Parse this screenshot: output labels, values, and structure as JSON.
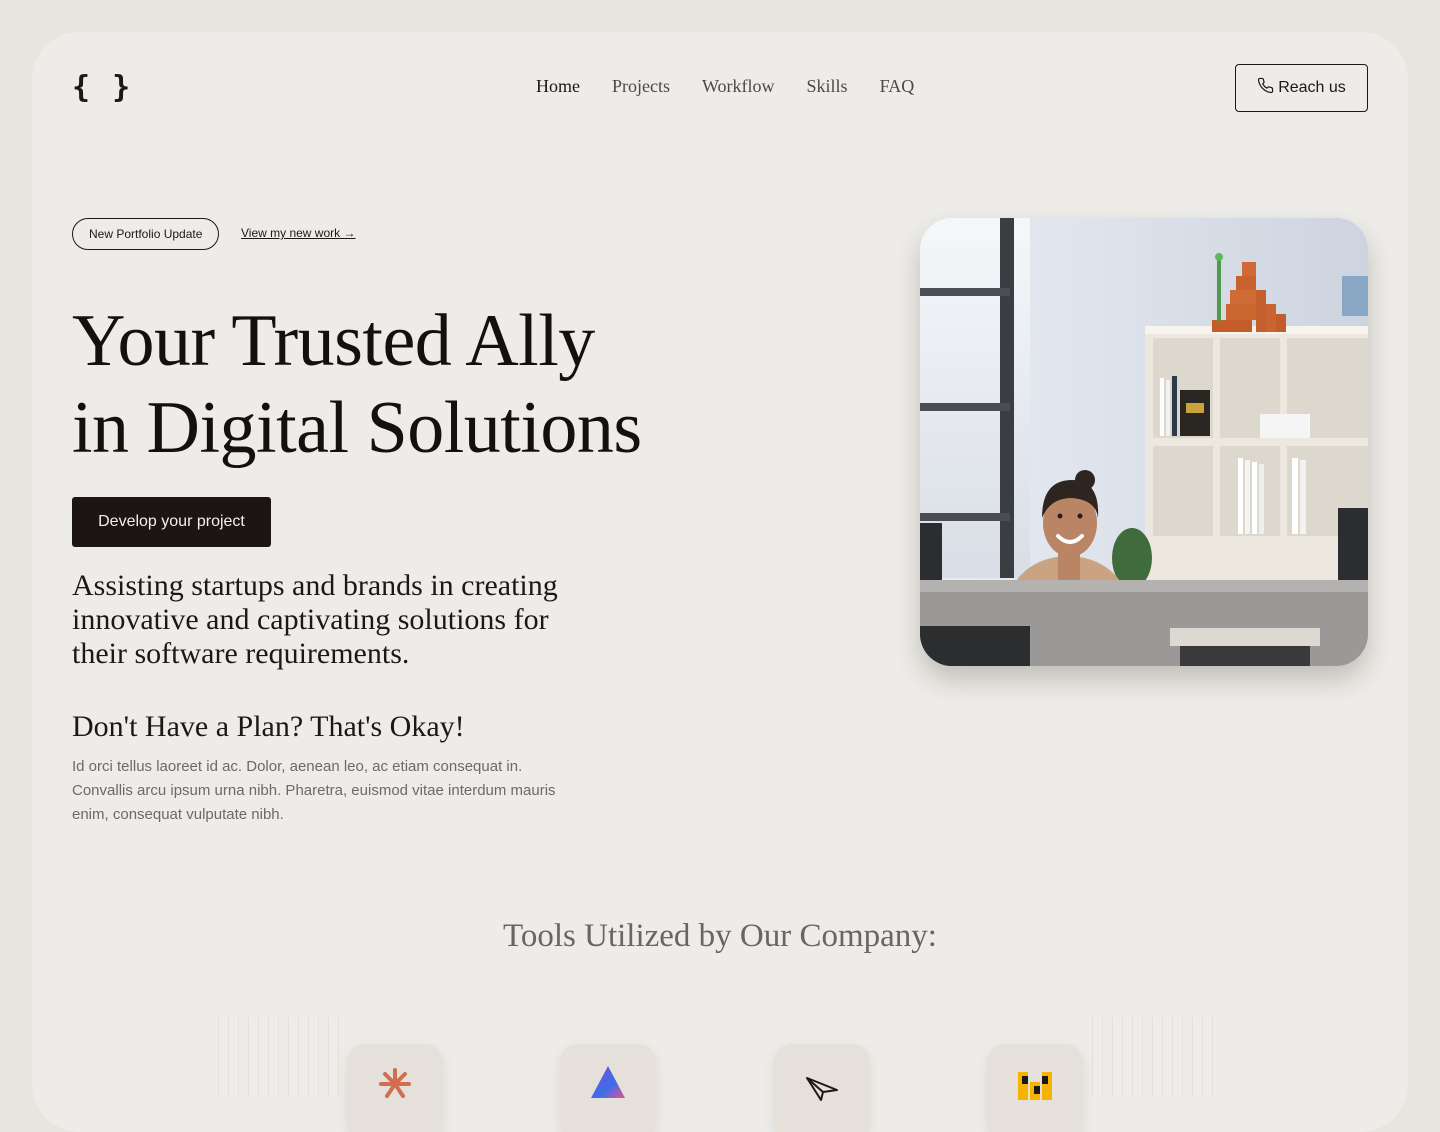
{
  "header": {
    "logo_text": "{ }",
    "nav": [
      {
        "label": "Home",
        "active": true
      },
      {
        "label": "Projects",
        "active": false
      },
      {
        "label": "Workflow",
        "active": false
      },
      {
        "label": "Skills",
        "active": false
      },
      {
        "label": "FAQ",
        "active": false
      }
    ],
    "reach_button": {
      "label": "Reach us",
      "icon": "phone-icon"
    }
  },
  "hero": {
    "badge": "New Portfolio Update",
    "view_link": "View my new work →",
    "title_line1": "Your Trusted Ally",
    "title_line2": "in Digital Solutions",
    "cta_label": "Develop your project",
    "subtitle": "Assisting startups and brands in creating innovative and captivating solutions for their software requirements.",
    "plan_heading": "Don't Have a Plan? That's Okay!",
    "body": "Id orci tellus laoreet id ac. Dolor, aenean leo, ac etiam consequat in. Convallis arcu ipsum urna nibh. Pharetra, euismod vitae interdum mauris enim, consequat vulputate nibh."
  },
  "tools": {
    "title": "Tools Utilized by Our Company:",
    "items": [
      {
        "icon": "claude-icon"
      },
      {
        "icon": "gradient-triangle-icon"
      },
      {
        "icon": "paper-plane-icon"
      },
      {
        "icon": "yellow-blocks-icon"
      }
    ]
  },
  "colors": {
    "page_bg": "#e8e5de",
    "panel_bg": "#eeece8",
    "primary_dark": "#1c1515",
    "muted_text": "#6e6967"
  }
}
